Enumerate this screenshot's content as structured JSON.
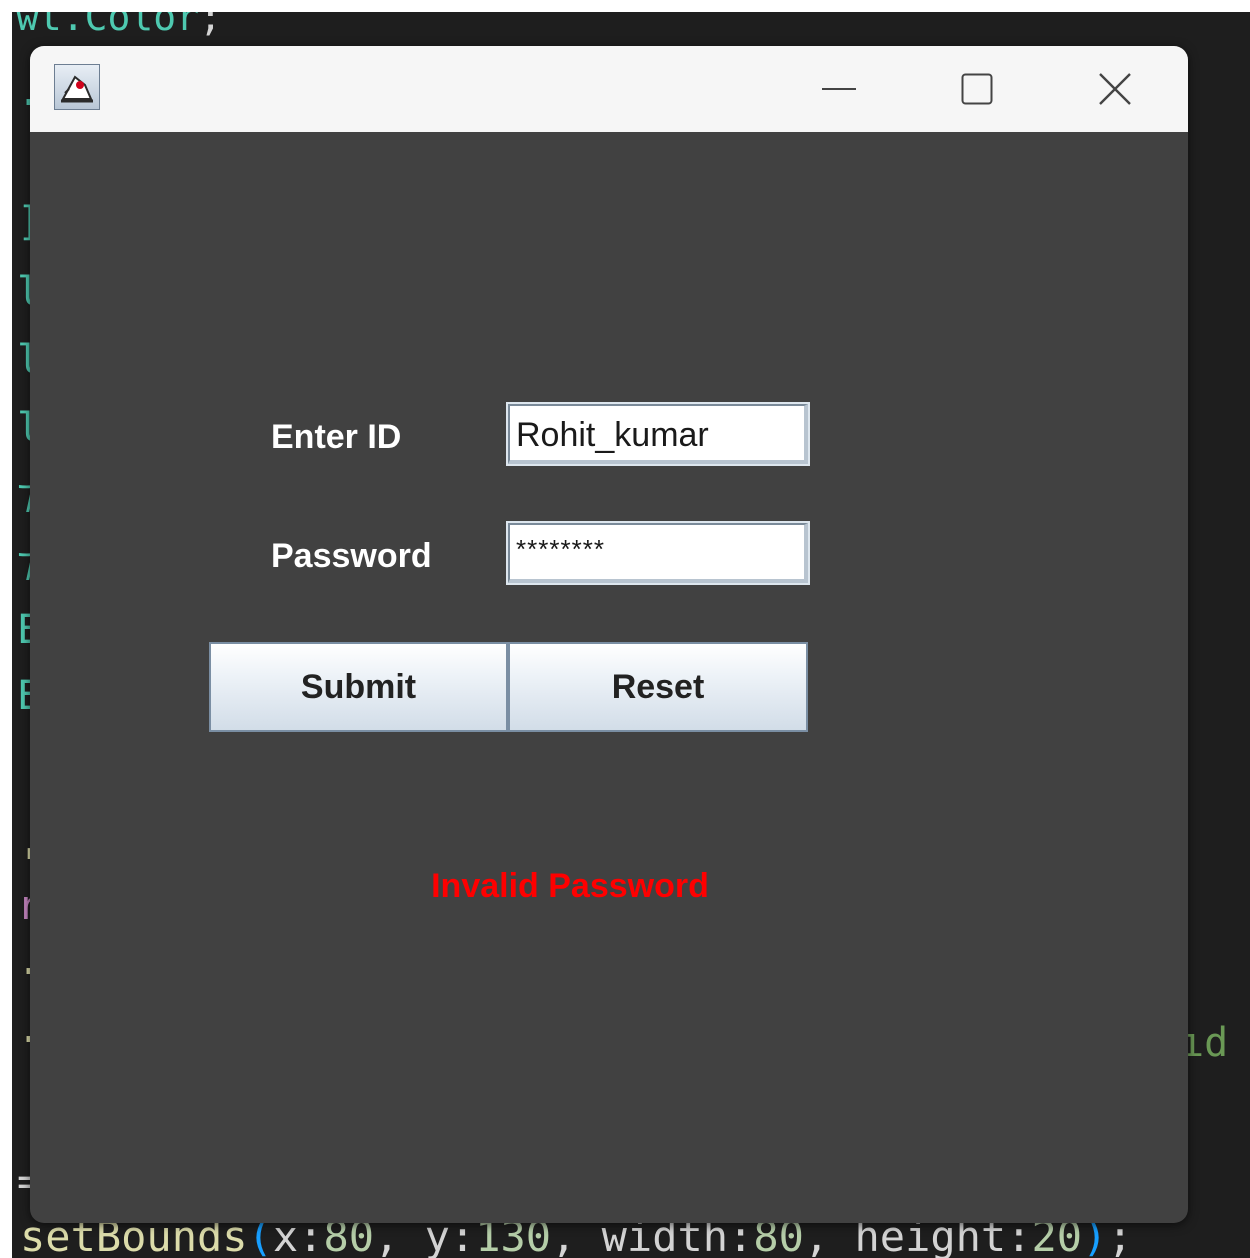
{
  "editor": {
    "top_code": "wt.Color",
    "top_code_punct": ";",
    "right_fragment": "ıd",
    "bottom_code": {
      "method": "setBounds",
      "open_paren": "(",
      "x_hint": "x:",
      "x_val": "80",
      "y_hint": "y:",
      "y_val": "130",
      "w_hint": "width:",
      "w_val": "80",
      "h_hint": "height:",
      "h_val": "20",
      "close_paren": ")",
      "end": ";"
    },
    "gutter_glyphs": [
      {
        "ch": ".c",
        "color": "#4ec9b0"
      },
      {
        "ch": "]",
        "color": "#4ec9b0"
      },
      {
        "ch": "l",
        "color": "#4ec9b0"
      },
      {
        "ch": "l",
        "color": "#4ec9b0"
      },
      {
        "ch": "l",
        "color": "#4ec9b0"
      },
      {
        "ch": "⁊",
        "color": "#4ec9b0"
      },
      {
        "ch": "⁊",
        "color": "#4ec9b0"
      },
      {
        "ch": "E",
        "color": "#4ec9b0"
      },
      {
        "ch": "E",
        "color": "#4ec9b0"
      },
      {
        "ch": "ˌg",
        "color": "#dcdcaa"
      },
      {
        "ch": "r",
        "color": "#c586c0"
      },
      {
        "ch": "·t",
        "color": "#dcdcaa"
      },
      {
        "ch": "·t",
        "color": "#dcdcaa"
      },
      {
        "ch": "=",
        "color": "#d4d4d4"
      }
    ]
  },
  "window": {
    "icon": "java-duke-icon",
    "controls": {
      "minimize": "minimize-icon",
      "maximize": "maximize-icon",
      "close": "close-icon"
    }
  },
  "form": {
    "id_label": "Enter ID",
    "id_value": "Rohit_kumar",
    "password_label": "Password",
    "password_value": "********",
    "submit_label": "Submit",
    "reset_label": "Reset",
    "message": "Invalid Password",
    "message_color": "#ff0000"
  },
  "colors": {
    "content_bg": "#414141",
    "titlebar_bg": "#f6f6f6",
    "editor_bg": "#1e1e1e"
  }
}
